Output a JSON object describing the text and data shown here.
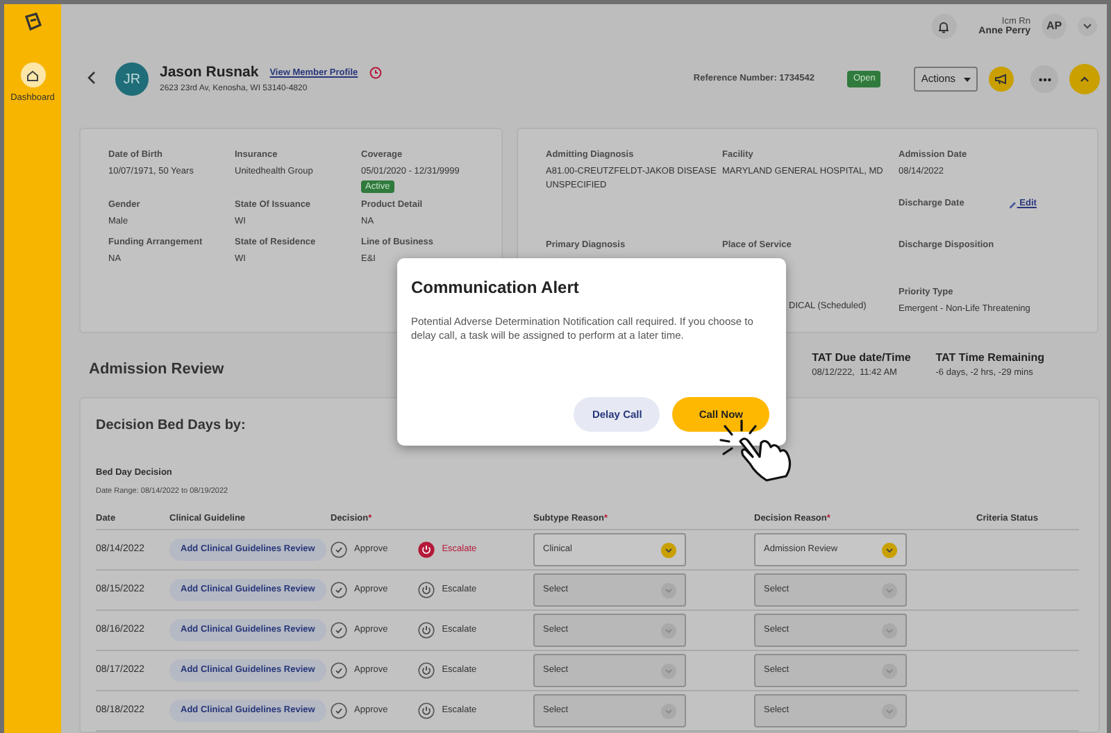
{
  "sidebar": {
    "items": [
      {
        "label": "Dashboard",
        "selected": true
      }
    ]
  },
  "topbar": {
    "role": "Icm Rn",
    "user": "Anne Perry",
    "initials": "AP"
  },
  "patient": {
    "initials": "JR",
    "name": "Jason Rusnak",
    "profile_link": "View Member Profile",
    "address": "2623 23rd Av, Kenosha, WI 53140-4820",
    "reference": "Reference Number: 1734542",
    "status": "Open",
    "actions": "Actions"
  },
  "member_card": {
    "rows": [
      [
        {
          "label": "Date of Birth",
          "value": "10/07/1971, 50 Years"
        },
        {
          "label": "Insurance",
          "value": "Unitedhealth Group"
        },
        {
          "label": "Coverage",
          "value": "05/01/2020 - 12/31/9999",
          "badge": "Active"
        }
      ],
      [
        {
          "label": "Gender",
          "value": "Male"
        },
        {
          "label": "State Of Issuance",
          "value": "WI"
        },
        {
          "label": "Product Detail",
          "value": "NA"
        }
      ],
      [
        {
          "label": "Funding Arrangement",
          "value": "NA"
        },
        {
          "label": "State of Residence",
          "value": "WI"
        },
        {
          "label": "Line of Business",
          "value": "E&I"
        }
      ]
    ]
  },
  "admission_card": {
    "rows": [
      [
        {
          "label": "Admitting Diagnosis",
          "value": "A81.00-CREUTZFELDT-JAKOB DISEASE UNSPECIFIED"
        },
        {
          "label": "Facility",
          "value": "MARYLAND GENERAL HOSPITAL, MD"
        },
        {
          "label": "Admission Date",
          "value": "08/14/2022"
        }
      ],
      [
        {},
        {},
        {
          "label": "Discharge Date",
          "link": "Edit"
        }
      ],
      [
        {
          "label": "Primary Diagnosis"
        },
        {
          "label": "Place of Service"
        },
        {
          "label": "Discharge Disposition"
        }
      ],
      [
        {},
        {
          "value": "DICAL (Scheduled)",
          "covered": true
        },
        {
          "label": "Priority Type",
          "value": "Emergent - Non-Life Threatening"
        }
      ]
    ]
  },
  "review": {
    "title": "Admission Review",
    "tat": [
      {
        "label": "TAT Due date/Time",
        "value": "08/12/222,  11:42 AM"
      },
      {
        "label": "TAT Time Remaining",
        "value": "-6 days, -2 hrs, -29 mins"
      }
    ]
  },
  "decision_card": {
    "title": "Decision Bed Days by:",
    "subtitle": "Bed Day Decision",
    "date_range": "Date Range: 08/14/2022 to 08/19/2022",
    "columns": [
      {
        "label": "Date"
      },
      {
        "label": "Clinical Guideline"
      },
      {
        "label": "Decision",
        "required_mark": "*"
      },
      {
        "label": "Subtype Reason",
        "required_mark": "*"
      },
      {
        "label": "Decision Reason",
        "required_mark": "*"
      },
      {
        "label": "Criteria Status"
      }
    ],
    "rows": [
      {
        "date": "08/14/2022",
        "guideline": "Add Clinical Guidelines Review",
        "approve": {
          "label": "Approve",
          "selected": false
        },
        "escalate": {
          "label": "Escalate",
          "selected": true
        },
        "subtype": {
          "value": "Clinical",
          "disabled": false
        },
        "reason": {
          "value": "Admission Review",
          "disabled": false
        }
      },
      {
        "date": "08/15/2022",
        "guideline": "Add Clinical Guidelines Review",
        "approve": {
          "label": "Approve",
          "selected": false
        },
        "escalate": {
          "label": "Escalate",
          "selected": false
        },
        "subtype": {
          "value": "Select",
          "disabled": true
        },
        "reason": {
          "value": "Select",
          "disabled": true
        }
      },
      {
        "date": "08/16/2022",
        "guideline": "Add Clinical Guidelines Review",
        "approve": {
          "label": "Approve",
          "selected": false
        },
        "escalate": {
          "label": "Escalate",
          "selected": false
        },
        "subtype": {
          "value": "Select",
          "disabled": true
        },
        "reason": {
          "value": "Select",
          "disabled": true
        }
      },
      {
        "date": "08/17/2022",
        "guideline": "Add Clinical Guidelines Review",
        "approve": {
          "label": "Approve",
          "selected": false
        },
        "escalate": {
          "label": "Escalate",
          "selected": false
        },
        "subtype": {
          "value": "Select",
          "disabled": true
        },
        "reason": {
          "value": "Select",
          "disabled": true
        }
      },
      {
        "date": "08/18/2022",
        "guideline": "Add Clinical Guidelines Review",
        "approve": {
          "label": "Approve",
          "selected": false
        },
        "escalate": {
          "label": "Escalate",
          "selected": false
        },
        "subtype": {
          "value": "Select",
          "disabled": true
        },
        "reason": {
          "value": "Select",
          "disabled": true
        }
      }
    ]
  },
  "modal": {
    "title": "Communication Alert",
    "body": "Potential Adverse Determination Notification call required. If you choose to delay call, a task will be assigned to perform at a later time.",
    "buttons": [
      {
        "label": "Delay Call",
        "kind": "secondary"
      },
      {
        "label": "Call Now",
        "kind": "primary"
      }
    ]
  }
}
